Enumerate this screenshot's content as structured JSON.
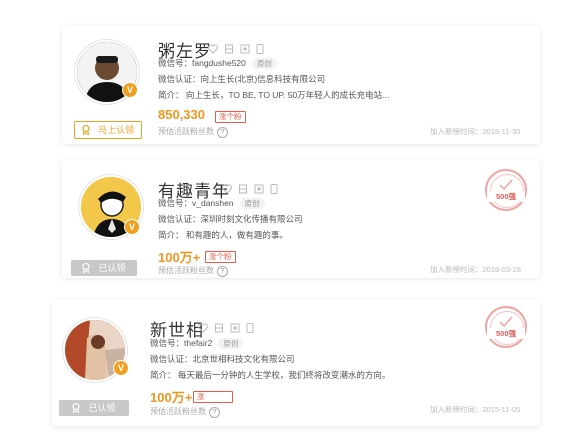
{
  "accounts": [
    {
      "name": "粥左罗",
      "wechat_id": "微信号：fangdushe520",
      "original_tag": "原创",
      "certification": "微信认证：向上生长(北京)信息科技有限公司",
      "intro": "简介：  向上生长，TO BE, TO UP. 50万年轻人的成长充电站...",
      "fans": "850,330",
      "fans_tag": "涨个粉",
      "estimate_label": "预估活跃粉丝数",
      "added_time": "加入新榜时间：2018-11-30",
      "auth_button": "马上认领",
      "badge": "",
      "avatar_badge": "V"
    },
    {
      "name": "有趣青年",
      "wechat_id": "微信号：v_danshen",
      "original_tag": "原创",
      "certification": "微信认证：深圳时刻文化传播有限公司",
      "intro": "简介：  和有趣的人，做有趣的事。",
      "fans": "100万+",
      "fans_tag": "涨个粉",
      "estimate_label": "预估活跃粉丝数",
      "added_time": "加入新榜时间：2018-03-28",
      "auth_button": "已认领",
      "badge": "500强",
      "avatar_badge": "V"
    },
    {
      "name": "新世相",
      "wechat_id": "微信号：thefair2",
      "original_tag": "原创",
      "certification": "微信认证：北京世相科技文化有限公司",
      "intro": "简介：  每天最后一分钟的人生学校，我们终将改变潮水的方向。",
      "fans": "100万+",
      "fans_tag": "涨",
      "estimate_label": "预估活跃粉丝数",
      "added_time": "加入新榜时间：2015-11-05",
      "auth_button": "已认领",
      "badge": "500强",
      "avatar_badge": "V"
    }
  ],
  "icons": [
    "heart-icon",
    "bookmark-icon",
    "qrcode-icon",
    "phone-icon",
    "award-icon",
    "help-icon"
  ],
  "colors": {
    "accent": "#f0a020",
    "fans": "#f0961e",
    "tag": "#ee5a4a",
    "stamp": "#e25a55",
    "disabled": "#c8c8c8"
  }
}
